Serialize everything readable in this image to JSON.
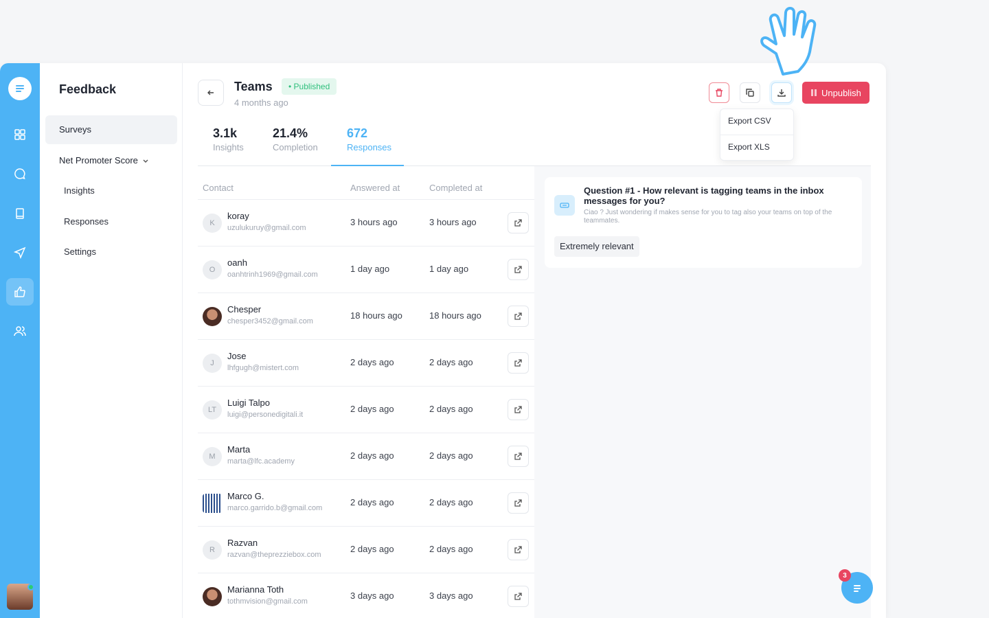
{
  "sidebar": {
    "title": "Feedback",
    "surveys": "Surveys",
    "nps": "Net Promoter Score",
    "sub": [
      "Insights",
      "Responses",
      "Settings"
    ]
  },
  "survey": {
    "title": "Teams",
    "status": "Published",
    "subtitle": "4 months ago"
  },
  "actions": {
    "unpublish": "Unpublish",
    "export_menu": [
      "Export CSV",
      "Export XLS"
    ]
  },
  "stats": [
    {
      "value": "3.1k",
      "label": "Insights"
    },
    {
      "value": "21.4%",
      "label": "Completion"
    },
    {
      "value": "672",
      "label": "Responses"
    }
  ],
  "table": {
    "headers": {
      "contact": "Contact",
      "answered": "Answered at",
      "completed": "Completed at"
    },
    "rows": [
      {
        "initial": "K",
        "name": "koray",
        "email": "uzulukuruy@gmail.com",
        "answered": "3 hours ago",
        "completed": "3 hours ago",
        "avatar": "initial"
      },
      {
        "initial": "O",
        "name": "oanh",
        "email": "oanhtrinh1969@gmail.com",
        "answered": "1 day ago",
        "completed": "1 day ago",
        "avatar": "initial"
      },
      {
        "initial": "",
        "name": "Chesper",
        "email": "chesper3452@gmail.com",
        "answered": "18 hours ago",
        "completed": "18 hours ago",
        "avatar": "photo"
      },
      {
        "initial": "J",
        "name": "Jose",
        "email": "lhfgugh@mistert.com",
        "answered": "2 days ago",
        "completed": "2 days ago",
        "avatar": "initial"
      },
      {
        "initial": "LT",
        "name": "Luigi Talpo",
        "email": "luigi@personedigitali.it",
        "answered": "2 days ago",
        "completed": "2 days ago",
        "avatar": "initial"
      },
      {
        "initial": "M",
        "name": "Marta",
        "email": "marta@lfc.academy",
        "answered": "2 days ago",
        "completed": "2 days ago",
        "avatar": "initial"
      },
      {
        "initial": "",
        "name": "Marco G.",
        "email": "marco.garrido.b@gmail.com",
        "answered": "2 days ago",
        "completed": "2 days ago",
        "avatar": "logo"
      },
      {
        "initial": "R",
        "name": "Razvan",
        "email": "razvan@theprezziebox.com",
        "answered": "2 days ago",
        "completed": "2 days ago",
        "avatar": "initial"
      },
      {
        "initial": "",
        "name": "Marianna Toth",
        "email": "tothmvision@gmail.com",
        "answered": "3 days ago",
        "completed": "3 days ago",
        "avatar": "photo"
      }
    ]
  },
  "question": {
    "title": "Question #1 - How relevant is tagging teams in the inbox messages for you?",
    "description": "Ciao ? Just wondering if makes sense for you to tag also your teams on top of the teammates.",
    "answer": "Extremely relevant"
  },
  "chat": {
    "badge": "3"
  },
  "colors": {
    "brand": "#4db3f5",
    "danger": "#e84560",
    "success": "#2fbf7c"
  }
}
